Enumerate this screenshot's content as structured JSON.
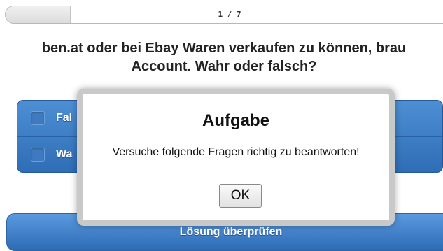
{
  "progress": {
    "text": "1 / 7",
    "current": 1,
    "total": 7,
    "fraction": 0.143
  },
  "question": {
    "text": "ben.at oder bei Ebay Waren verkaufen zu können, brau\nAccount. Wahr oder falsch?"
  },
  "options": [
    {
      "label": "Fal",
      "checked": false
    },
    {
      "label": "Wa",
      "checked": false
    }
  ],
  "check_button": {
    "label": "Lösung überprüfen"
  },
  "dialog": {
    "title": "Aufgabe",
    "message": "Versuche folgende Fragen richtig zu beantworten!",
    "ok_label": "OK"
  },
  "colors": {
    "accent": "#3a7cc4",
    "dialog_border": "#c9c9c9"
  }
}
